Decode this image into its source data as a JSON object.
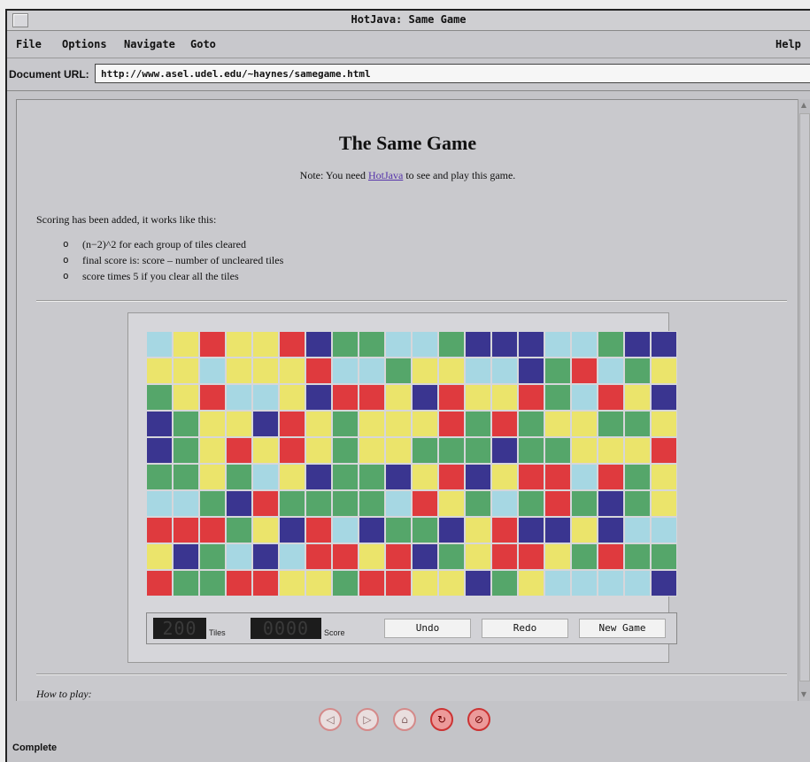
{
  "window": {
    "title": "HotJava: Same Game"
  },
  "menu": {
    "file": "File",
    "options": "Options",
    "navigate": "Navigate",
    "goto": "Goto",
    "help": "Help"
  },
  "url": {
    "label": "Document URL:",
    "value": "http://www.asel.udel.edu/~haynes/samegame.html"
  },
  "page": {
    "title": "The Same Game",
    "note_prefix": "Note: You need ",
    "note_link": "HotJava",
    "note_suffix": " to see and play this game.",
    "scoring_intro": "Scoring has been added, it works like this:",
    "rules": [
      "(n−2)^2 for each group of tiles cleared",
      "final score is: score – number of uncleared tiles",
      "score times 5 if you clear all the tiles"
    ],
    "rule_bullet": "o",
    "how_to_play": "How to play:"
  },
  "game": {
    "tiles_value": "200",
    "tiles_label": "Tiles",
    "score_value": "0000",
    "score_label": "Score",
    "undo_label": "Undo",
    "redo_label": "Redo",
    "new_game_label": "New Game",
    "colors": {
      "c": "#a6d7e3",
      "y": "#ebe46b",
      "r": "#df3a3e",
      "g": "#55a66a",
      "b": "#3a3590"
    },
    "grid": [
      "cyryyrbggccgbbbccgbb",
      "yycyyyrccgyyccbgrcgy",
      "gyrccybrrybryyrgcryb",
      "bgyybrygyyyrgrgyyggy",
      "bgyryrygyygggbggyyyr",
      "ggygcybggbyrbyrrcrgy",
      "ccgbrggggcrygcgrgbgy",
      "rrrgybrcbggbyrbbybcc",
      "ybgcbcrryrbgyrrygrgg",
      "rggrryygrryybgyccccb"
    ]
  },
  "nav": {
    "back": "◁",
    "forward": "▷",
    "home": "⌂",
    "reload": "↻",
    "stop": "⊘"
  },
  "status": "Complete"
}
